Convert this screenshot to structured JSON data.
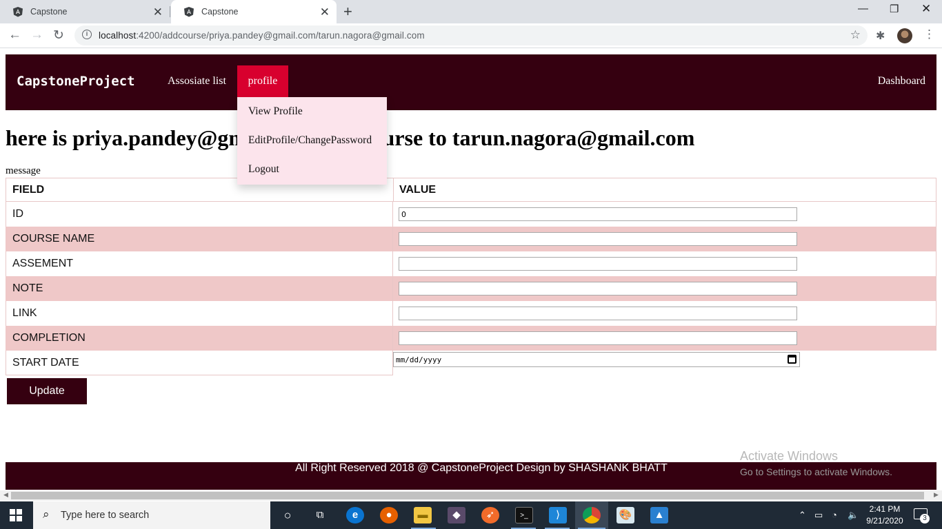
{
  "browser": {
    "tabs": [
      {
        "title": "Capstone",
        "favicon": "angular-logo-icon"
      },
      {
        "title": "Capstone",
        "favicon": "angular-logo-icon"
      }
    ],
    "url_host": "localhost",
    "url_path": ":4200/addcourse/priya.pandey@gmail.com/tarun.nagora@gmail.com"
  },
  "navbar": {
    "brand": "CapstoneProject",
    "links": {
      "associates": "Assosiate list",
      "profile": "profile",
      "dashboard": "Dashboard"
    },
    "bg_color": "#350010",
    "active_color": "#d8002e"
  },
  "profile_menu": {
    "items": [
      "View Profile",
      "EditProfile/ChangePassword",
      "Logout"
    ]
  },
  "page": {
    "heading": "here is priya.pandey@gmail.com add course to tarun.nagora@gmail.com",
    "message_label": "message"
  },
  "form": {
    "headers": {
      "field": "FIELD",
      "value": "VALUE"
    },
    "rows": [
      {
        "label": "ID",
        "value": "0"
      },
      {
        "label": "COURSE NAME",
        "value": ""
      },
      {
        "label": "ASSEMENT",
        "value": ""
      },
      {
        "label": "NOTE",
        "value": ""
      },
      {
        "label": "LINK",
        "value": ""
      },
      {
        "label": "COMPLETION",
        "value": ""
      },
      {
        "label": "START DATE",
        "value": "mm/dd/yyyy"
      }
    ],
    "submit_label": "Update"
  },
  "footer": {
    "text": "All Right Reserved 2018 @ CapstoneProject Design by SHASHANK BHATT"
  },
  "watermark": {
    "title": "Activate Windows",
    "subtitle": "Go to Settings to activate Windows."
  },
  "taskbar": {
    "search_placeholder": "Type here to search",
    "time": "2:41 PM",
    "date": "9/21/2020",
    "notifications": "3"
  }
}
